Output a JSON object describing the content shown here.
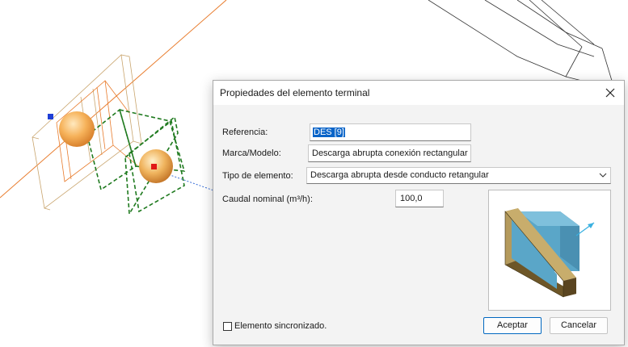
{
  "dialog": {
    "title": "Propiedades del elemento terminal",
    "close_icon": "close-icon"
  },
  "form": {
    "referencia_label": "Referencia:",
    "referencia_value": "DES [9]",
    "marca_label": "Marca/Modelo:",
    "marca_value": "Descarga abrupta conexión rectangular",
    "tipo_label": "Tipo de elemento:",
    "tipo_value": "Descarga abrupta desde conducto retangular",
    "caudal_label": "Caudal nominal (m³/h):",
    "caudal_value": "100,0"
  },
  "footer": {
    "sync_label": "Elemento sincronizado.",
    "sync_checked": false,
    "accept_label": "Aceptar",
    "cancel_label": "Cancelar"
  },
  "colors": {
    "accent": "#0067c0",
    "selection": "#0a64c8",
    "cad_orange": "#e87a2a",
    "cad_green": "#1f7a1f"
  }
}
